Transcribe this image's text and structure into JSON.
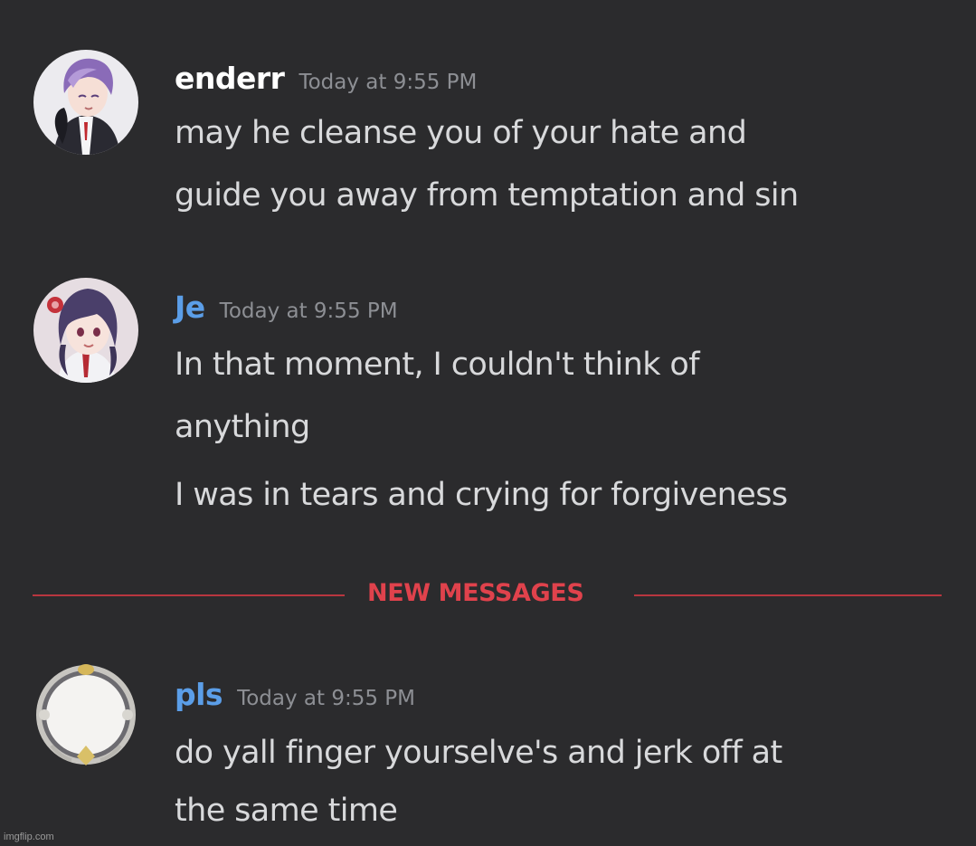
{
  "colors": {
    "background": "#2b2b2d",
    "message_text": "#d8d9db",
    "timestamp": "#8d8f94",
    "new_messages_red": "#e0424c",
    "username_white": "#ffffff",
    "username_blue": "#5b9ee8"
  },
  "messages": [
    {
      "username": "enderr",
      "username_color": "#ffffff",
      "timestamp": "Today at 9:55 PM",
      "avatar_icon": "anime-avatar-purple-hair",
      "lines": [
        "may he cleanse you of your hate and",
        "guide you away from temptation and sin"
      ]
    },
    {
      "username": "Je",
      "username_color": "#5b9ee8",
      "timestamp": "Today at 9:55 PM",
      "avatar_icon": "anime-avatar-dark-hair",
      "lines": [
        "In that moment, I couldn't think of",
        "anything",
        "I was in tears and crying for forgiveness"
      ]
    },
    {
      "username": "pls",
      "username_color": "#5b9ee8",
      "timestamp": "Today at 9:55 PM",
      "avatar_icon": "white-ornate-frame-avatar",
      "lines": [
        "do yall finger yourselve's and jerk off at",
        "the same time"
      ]
    }
  ],
  "divider": {
    "label": "NEW MESSAGES"
  },
  "watermark": "imgflip.com"
}
